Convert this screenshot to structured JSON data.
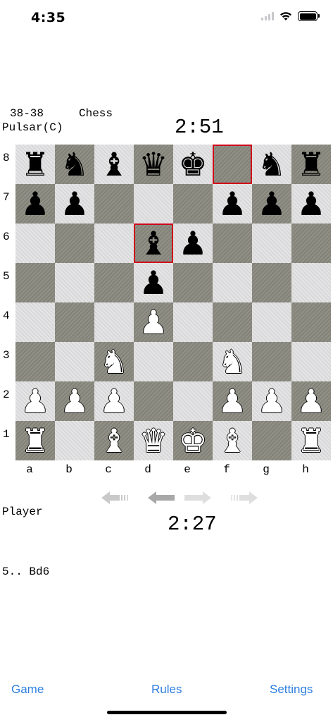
{
  "status_bar": {
    "time": "4:35"
  },
  "header": {
    "score": "38-38",
    "game_type": "Chess",
    "opponent": "Pulsar(C)",
    "opponent_clock": "2:51"
  },
  "board": {
    "ranks": [
      "8",
      "7",
      "6",
      "5",
      "4",
      "3",
      "2",
      "1"
    ],
    "files": [
      "a",
      "b",
      "c",
      "d",
      "e",
      "f",
      "g",
      "h"
    ],
    "rows": [
      [
        "bR",
        "bN",
        "bB",
        "bQ",
        "bK",
        "",
        "bN",
        "bR"
      ],
      [
        "bP",
        "bP",
        "",
        "",
        "",
        "bP",
        "bP",
        "bP"
      ],
      [
        "",
        "",
        "",
        "bB",
        "bP",
        "",
        "",
        ""
      ],
      [
        "",
        "",
        "",
        "bP",
        "",
        "",
        "",
        ""
      ],
      [
        "",
        "",
        "",
        "wP",
        "",
        "",
        "",
        ""
      ],
      [
        "",
        "",
        "wN",
        "",
        "",
        "wN",
        "",
        ""
      ],
      [
        "wP",
        "wP",
        "wP",
        "",
        "",
        "wP",
        "wP",
        "wP"
      ],
      [
        "wR",
        "",
        "wB",
        "wQ",
        "wK",
        "wB",
        "",
        "wR"
      ]
    ],
    "highlighted_squares": [
      "f8",
      "d6"
    ],
    "colors": {
      "light": "#dcdcde",
      "dark": "#8a8a80",
      "highlight": "#d0021b"
    }
  },
  "controls": {
    "arrows": [
      {
        "name": "first-move-icon",
        "enabled": false
      },
      {
        "name": "previous-move-icon",
        "enabled": true
      },
      {
        "name": "next-move-icon",
        "enabled": false
      },
      {
        "name": "last-move-icon",
        "enabled": false
      }
    ]
  },
  "player": {
    "name": "Player",
    "clock": "2:27"
  },
  "moves": {
    "text": "5.. Bd6"
  },
  "tabbar": {
    "game": "Game",
    "rules": "Rules",
    "settings": "Settings",
    "accent": "#2f7fe0"
  }
}
